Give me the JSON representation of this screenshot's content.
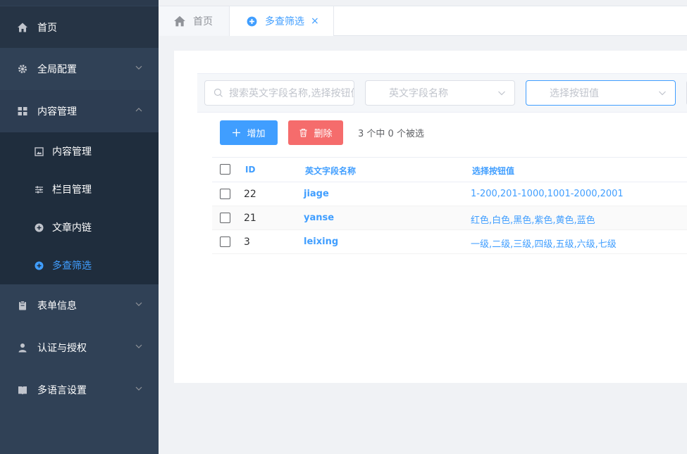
{
  "sidebar": {
    "items": [
      {
        "label": "首页",
        "icon": "home-icon"
      },
      {
        "label": "全局配置",
        "icon": "gear-icon"
      },
      {
        "label": "内容管理",
        "icon": "grid-icon"
      },
      {
        "label": "表单信息",
        "icon": "clipboard-icon"
      },
      {
        "label": "认证与授权",
        "icon": "user-icon"
      },
      {
        "label": "多语言设置",
        "icon": "book-icon"
      }
    ],
    "submenu": [
      {
        "label": "内容管理",
        "icon": "picture-icon"
      },
      {
        "label": "栏目管理",
        "icon": "sliders-icon"
      },
      {
        "label": "文章内链",
        "icon": "circle-plus-icon"
      },
      {
        "label": "多查筛选",
        "icon": "circle-plus-icon",
        "active": true
      }
    ]
  },
  "tabs": {
    "home": "首页",
    "active": "多查筛选",
    "close": "×"
  },
  "toolbar": {
    "search_placeholder": "搜索英文字段名称,选择按钮值",
    "select1_placeholder": "英文字段名称",
    "select2_placeholder": "选择按钮值",
    "add_label": "增加",
    "delete_label": "删除",
    "selection_text": "3 个中 0 个被选"
  },
  "table": {
    "headers": {
      "id": "ID",
      "name": "英文字段名称",
      "value": "选择按钮值"
    },
    "rows": [
      {
        "id": "22",
        "name": "jiage",
        "value": "1-200,201-1000,1001-2000,2001"
      },
      {
        "id": "21",
        "name": "yanse",
        "value": "红色,白色,黑色,紫色,黄色,蓝色"
      },
      {
        "id": "3",
        "name": "leixing",
        "value": "一级,二级,三级,四级,五级,六级,七级"
      }
    ]
  },
  "colors": {
    "sidebar_bg": "#304156",
    "accent": "#409eff",
    "danger": "#f56c6c"
  }
}
